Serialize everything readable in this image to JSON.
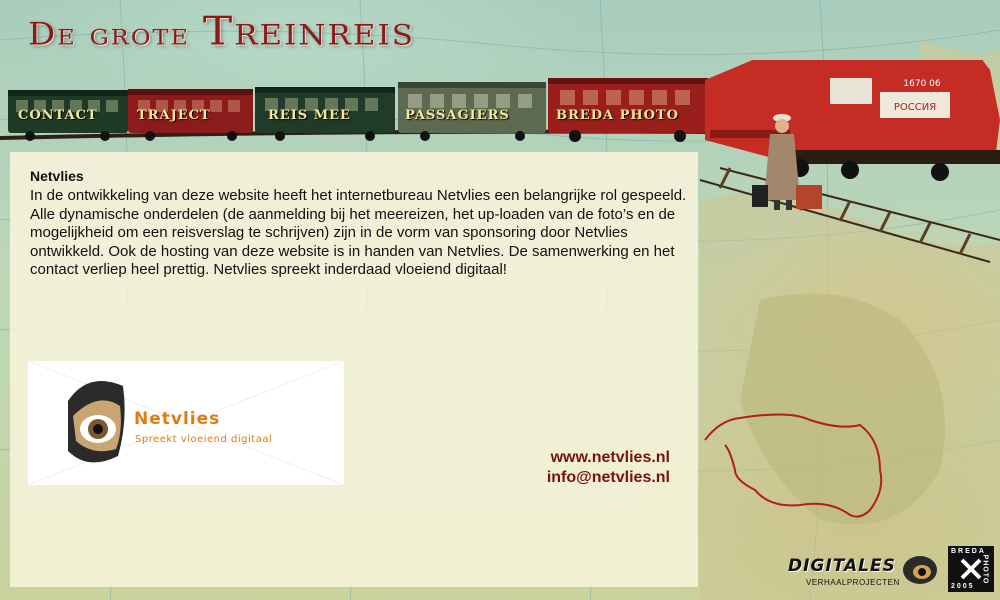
{
  "header": {
    "title_left": "De grote",
    "title_right": "Treinreis"
  },
  "nav": {
    "contact": "CONTACT",
    "traject": "TRAJECT",
    "reis_mee": "REIS MEE",
    "passagiers": "PASSAGIERS",
    "breda_photo": "BREDA PHOTO"
  },
  "locomotive": {
    "number": "1670 06",
    "sign": "РОССИЯ"
  },
  "content": {
    "heading": "Netvlies",
    "body": "In de ontwikkeling van deze website heeft het internetbureau Netvlies een belangrijke rol gespeeld. Alle dynamische onderdelen (de aanmelding bij het meereizen, het up-loaden van de foto’s en de mogelijkheid om een reisverslag te schrijven) zijn in de vorm van sponsoring door Netvlies ontwikkeld. Ook de hosting van deze website is in handen van Netvlies. De samenwerking en het contact verliep heel prettig. Netvlies spreekt inderdaad vloeiend digitaal!",
    "logo": {
      "name": "Netvlies",
      "slogan": "Spreekt vloeiend digitaal"
    },
    "website": "www.netvlies.nl",
    "email": "info@netvlies.nl"
  },
  "footer": {
    "digitales": "DIGITALES",
    "digitales_sub": "VERHAALPROJECTEN",
    "bredaphoto_top": "BREDA",
    "bredaphoto_side": "PHOTO",
    "bredaphoto_year": "2005"
  },
  "colors": {
    "accent": "#7a1010",
    "nav_text": "#f6e79a",
    "logo_orange": "#e07a14"
  }
}
